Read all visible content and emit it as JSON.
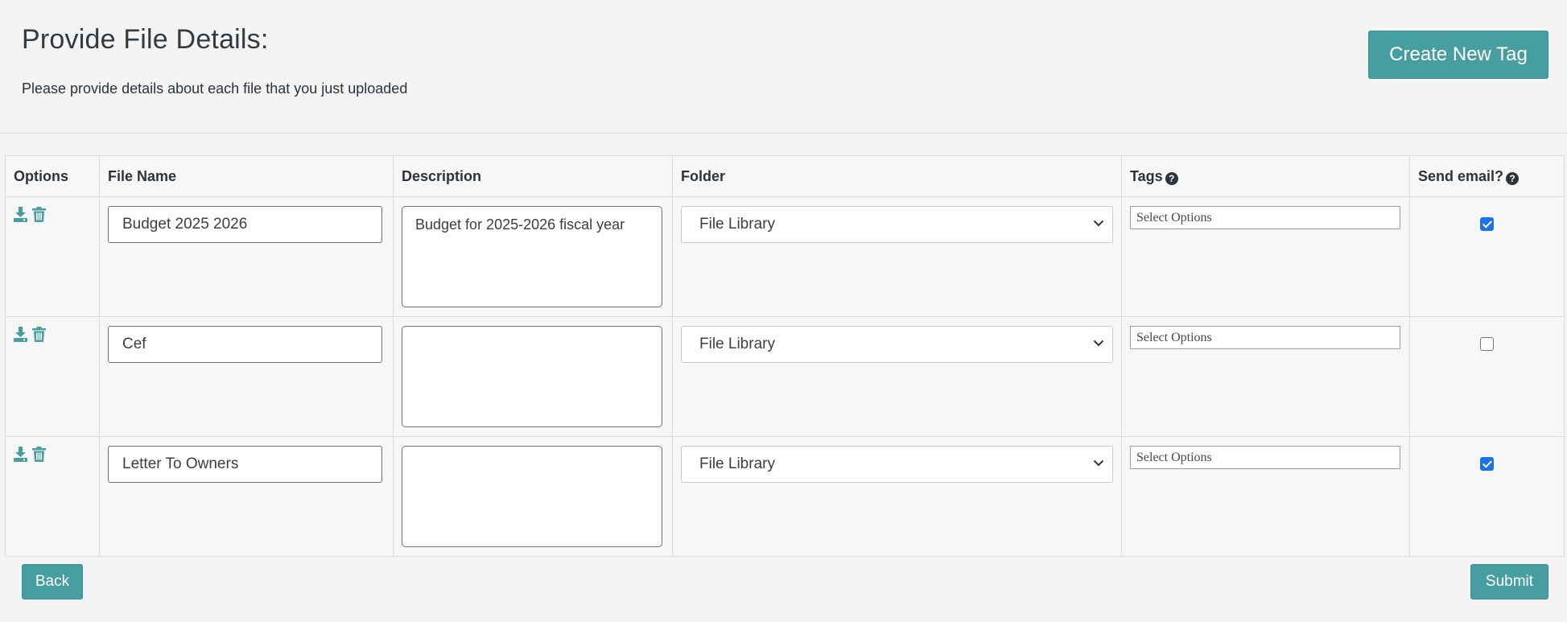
{
  "header": {
    "title": "Provide File Details:",
    "subtitle": "Please provide details about each file that you just uploaded",
    "create_tag_label": "Create New Tag"
  },
  "table": {
    "headers": {
      "options": "Options",
      "file_name": "File Name",
      "description": "Description",
      "folder": "Folder",
      "tags": "Tags",
      "send_email": "Send email?"
    },
    "rows": [
      {
        "file_name": "Budget 2025 2026",
        "description": "Budget for 2025-2026 fiscal year",
        "folder": "File Library",
        "tags_placeholder": "Select Options",
        "send_email": true
      },
      {
        "file_name": "Cef",
        "description": "",
        "folder": "File Library",
        "tags_placeholder": "Select Options",
        "send_email": false
      },
      {
        "file_name": "Letter To Owners",
        "description": "",
        "folder": "File Library",
        "tags_placeholder": "Select Options",
        "send_email": true
      }
    ]
  },
  "footer": {
    "back_label": "Back",
    "submit_label": "Submit"
  },
  "icons": [
    "download-icon",
    "trash-icon",
    "question-circle-icon",
    "chevron-down-icon"
  ],
  "colors": {
    "accent": "#479ea0",
    "background": "#f4f4f4",
    "checkbox_checked": "#1a73e8"
  }
}
